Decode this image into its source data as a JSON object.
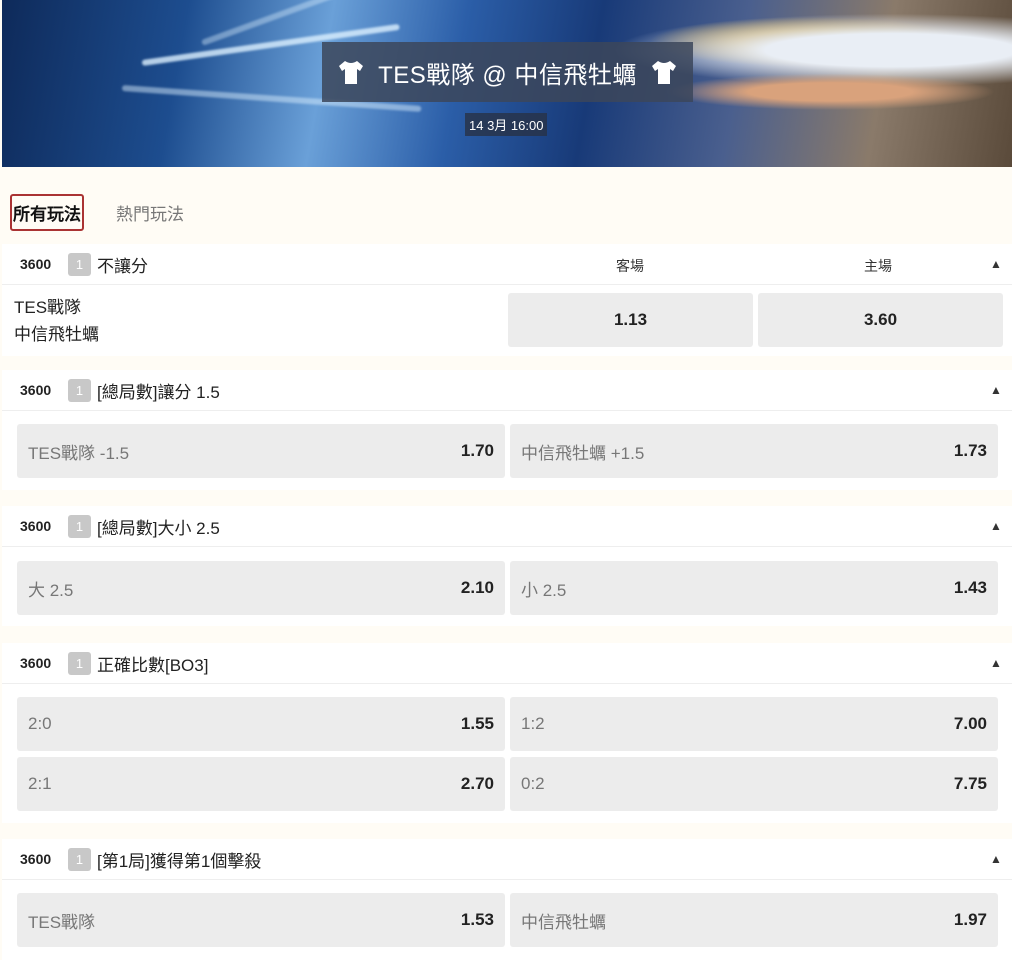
{
  "header": {
    "title": "TES戰隊 @ 中信飛牡蠣",
    "date": "14 3月 16:00",
    "home_shirt_icon": "shirt-icon",
    "away_shirt_icon": "shirt-icon"
  },
  "tabs": [
    {
      "label": "所有玩法",
      "active": true
    },
    {
      "label": "熱門玩法",
      "active": false
    }
  ],
  "markets": [
    {
      "id": "3600",
      "num": "1",
      "title": "不讓分",
      "col_away": "客場",
      "col_home": "主場",
      "team1": "TES戰隊",
      "team2": "中信飛牡蠣",
      "odds_away": "1.13",
      "odds_home": "3.60"
    },
    {
      "id": "3600",
      "num": "1",
      "title": "[總局數]讓分 1.5",
      "left_label": "TES戰隊 -1.5",
      "left_val": "1.70",
      "right_label": "中信飛牡蠣 +1.5",
      "right_val": "1.73"
    },
    {
      "id": "3600",
      "num": "1",
      "title": "[總局數]大小 2.5",
      "left_label": "大 2.5",
      "left_val": "2.10",
      "right_label": "小 2.5",
      "right_val": "1.43"
    },
    {
      "id": "3600",
      "num": "1",
      "title": "正確比數[BO3]",
      "rows": [
        {
          "left_label": "2:0",
          "left_val": "1.55",
          "right_label": "1:2",
          "right_val": "7.00"
        },
        {
          "left_label": "2:1",
          "left_val": "2.70",
          "right_label": "0:2",
          "right_val": "7.75"
        }
      ]
    },
    {
      "id": "3600",
      "num": "1",
      "title": "[第1局]獲得第1個擊殺",
      "left_label": "TES戰隊",
      "left_val": "1.53",
      "right_label": "中信飛牡蠣",
      "right_val": "1.97"
    }
  ]
}
